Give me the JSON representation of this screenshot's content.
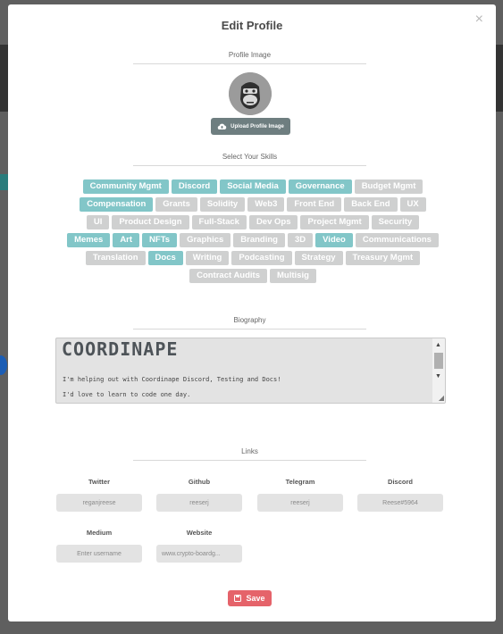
{
  "modal": {
    "title": "Edit Profile",
    "close_symbol": "×"
  },
  "profile_image": {
    "section_title": "Profile Image",
    "upload_label": "Upload Profile Image",
    "avatar_icon": "ape-avatar-icon",
    "upload_icon": "cloud-upload-icon"
  },
  "skills": {
    "section_title": "Select Your Skills",
    "rows": [
      [
        {
          "label": "Community Mgmt",
          "selected": true
        },
        {
          "label": "Discord",
          "selected": true
        },
        {
          "label": "Social Media",
          "selected": true
        },
        {
          "label": "Governance",
          "selected": true
        },
        {
          "label": "Budget Mgmt",
          "selected": false
        }
      ],
      [
        {
          "label": "Compensation",
          "selected": true
        },
        {
          "label": "Grants",
          "selected": false
        },
        {
          "label": "Solidity",
          "selected": false
        },
        {
          "label": "Web3",
          "selected": false
        },
        {
          "label": "Front End",
          "selected": false
        },
        {
          "label": "Back End",
          "selected": false
        },
        {
          "label": "UX",
          "selected": false
        }
      ],
      [
        {
          "label": "UI",
          "selected": false
        },
        {
          "label": "Product Design",
          "selected": false
        },
        {
          "label": "Full-Stack",
          "selected": false
        },
        {
          "label": "Dev Ops",
          "selected": false
        },
        {
          "label": "Project Mgmt",
          "selected": false
        },
        {
          "label": "Security",
          "selected": false
        }
      ],
      [
        {
          "label": "Memes",
          "selected": true
        },
        {
          "label": "Art",
          "selected": true
        },
        {
          "label": "NFTs",
          "selected": true
        },
        {
          "label": "Graphics",
          "selected": false
        },
        {
          "label": "Branding",
          "selected": false
        },
        {
          "label": "3D",
          "selected": false
        },
        {
          "label": "Video",
          "selected": true
        },
        {
          "label": "Communications",
          "selected": false
        }
      ],
      [
        {
          "label": "Translation",
          "selected": false
        },
        {
          "label": "Docs",
          "selected": true
        },
        {
          "label": "Writing",
          "selected": false
        },
        {
          "label": "Podcasting",
          "selected": false
        },
        {
          "label": "Strategy",
          "selected": false
        },
        {
          "label": "Treasury Mgmt",
          "selected": false
        }
      ],
      [
        {
          "label": "Contract Audits",
          "selected": false
        },
        {
          "label": "Multisig",
          "selected": false
        }
      ]
    ]
  },
  "biography": {
    "section_title": "Biography",
    "logo_text": "COORDINAPE",
    "lines": [
      "I'm helping out with Coordinape Discord, Testing and Docs!",
      "I'd love to learn to code one day."
    ]
  },
  "links": {
    "section_title": "Links",
    "twitter": {
      "label": "Twitter",
      "value": "reganjreese"
    },
    "github": {
      "label": "Github",
      "value": "reeserj"
    },
    "telegram": {
      "label": "Telegram",
      "value": "reeserj"
    },
    "discord": {
      "label": "Discord",
      "value": "Reese#5964"
    },
    "medium": {
      "label": "Medium",
      "placeholder": "Enter username"
    },
    "website": {
      "label": "Website",
      "value": "www.crypto-boardg..."
    }
  },
  "save_label": "Save",
  "colors": {
    "selected_chip": "#82c6c8",
    "unselected_chip": "#cfd0d0",
    "save_button": "#e5636a",
    "upload_button": "#6e7e80"
  }
}
